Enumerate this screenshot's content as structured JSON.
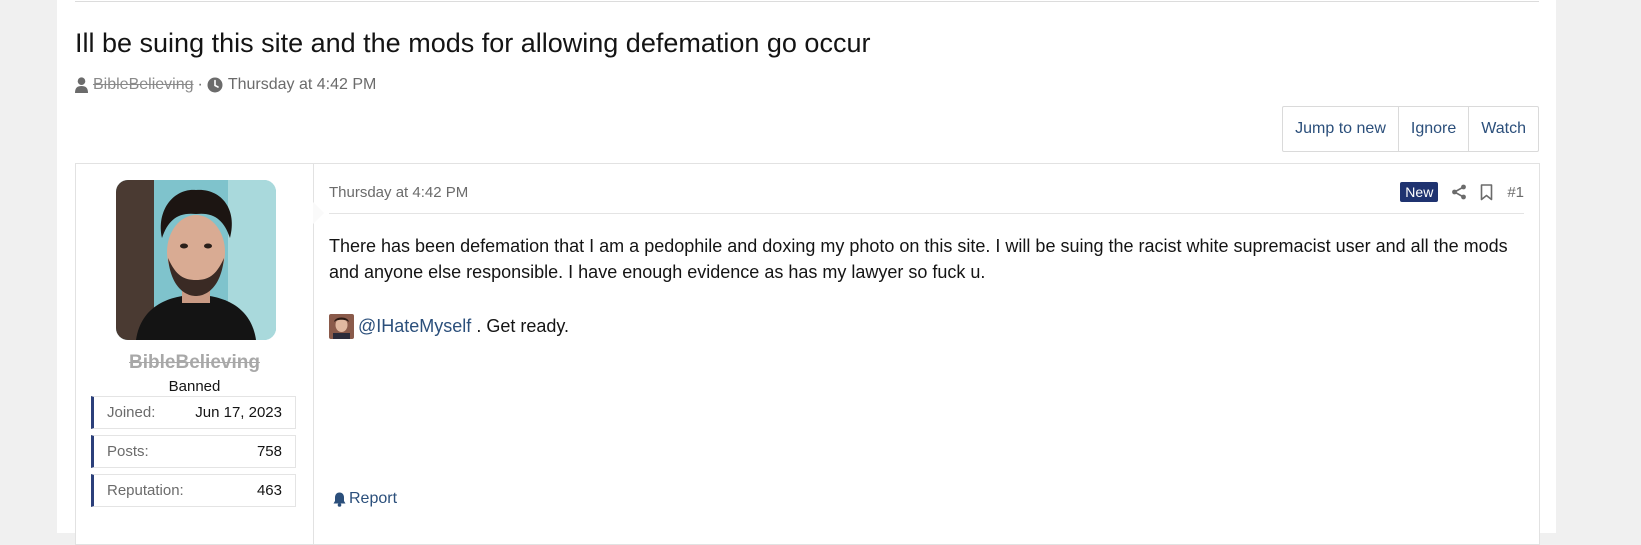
{
  "thread": {
    "title": "Ill be suing this site and the mods for allowing defemation go occur",
    "author": "BibleBelieving",
    "separator": "·",
    "date": "Thursday at 4:42 PM"
  },
  "thread_actions": {
    "jump_to_new": "Jump to new",
    "ignore": "Ignore",
    "watch": "Watch"
  },
  "post": {
    "username": "BibleBelieving",
    "user_title": "Banned",
    "stats": [
      {
        "label": "Joined:",
        "value": "Jun 17, 2023"
      },
      {
        "label": "Posts:",
        "value": "758"
      },
      {
        "label": "Reputation:",
        "value": "463"
      }
    ],
    "date": "Thursday at 4:42 PM",
    "badge": "New",
    "number": "#1",
    "body": "There has been defemation that I am a pedophile and doxing my photo on this site. I will be suing the racist white supremacist user and all the mods and anyone else responsible. I have enough evidence as has my lawyer so fuck u.",
    "mention": "@IHateMyself",
    "mention_suffix": " . Get ready.",
    "report_label": "Report"
  },
  "icons": {
    "author": "user-icon",
    "date": "clock-icon",
    "share": "share-icon",
    "bookmark": "bookmark-icon",
    "report": "bell-icon"
  },
  "colors": {
    "link": "#2b4f7b",
    "badge_new": "#1f3370",
    "stat_accent": "#2b3f7a",
    "banned_username": "#a8a8a8"
  }
}
